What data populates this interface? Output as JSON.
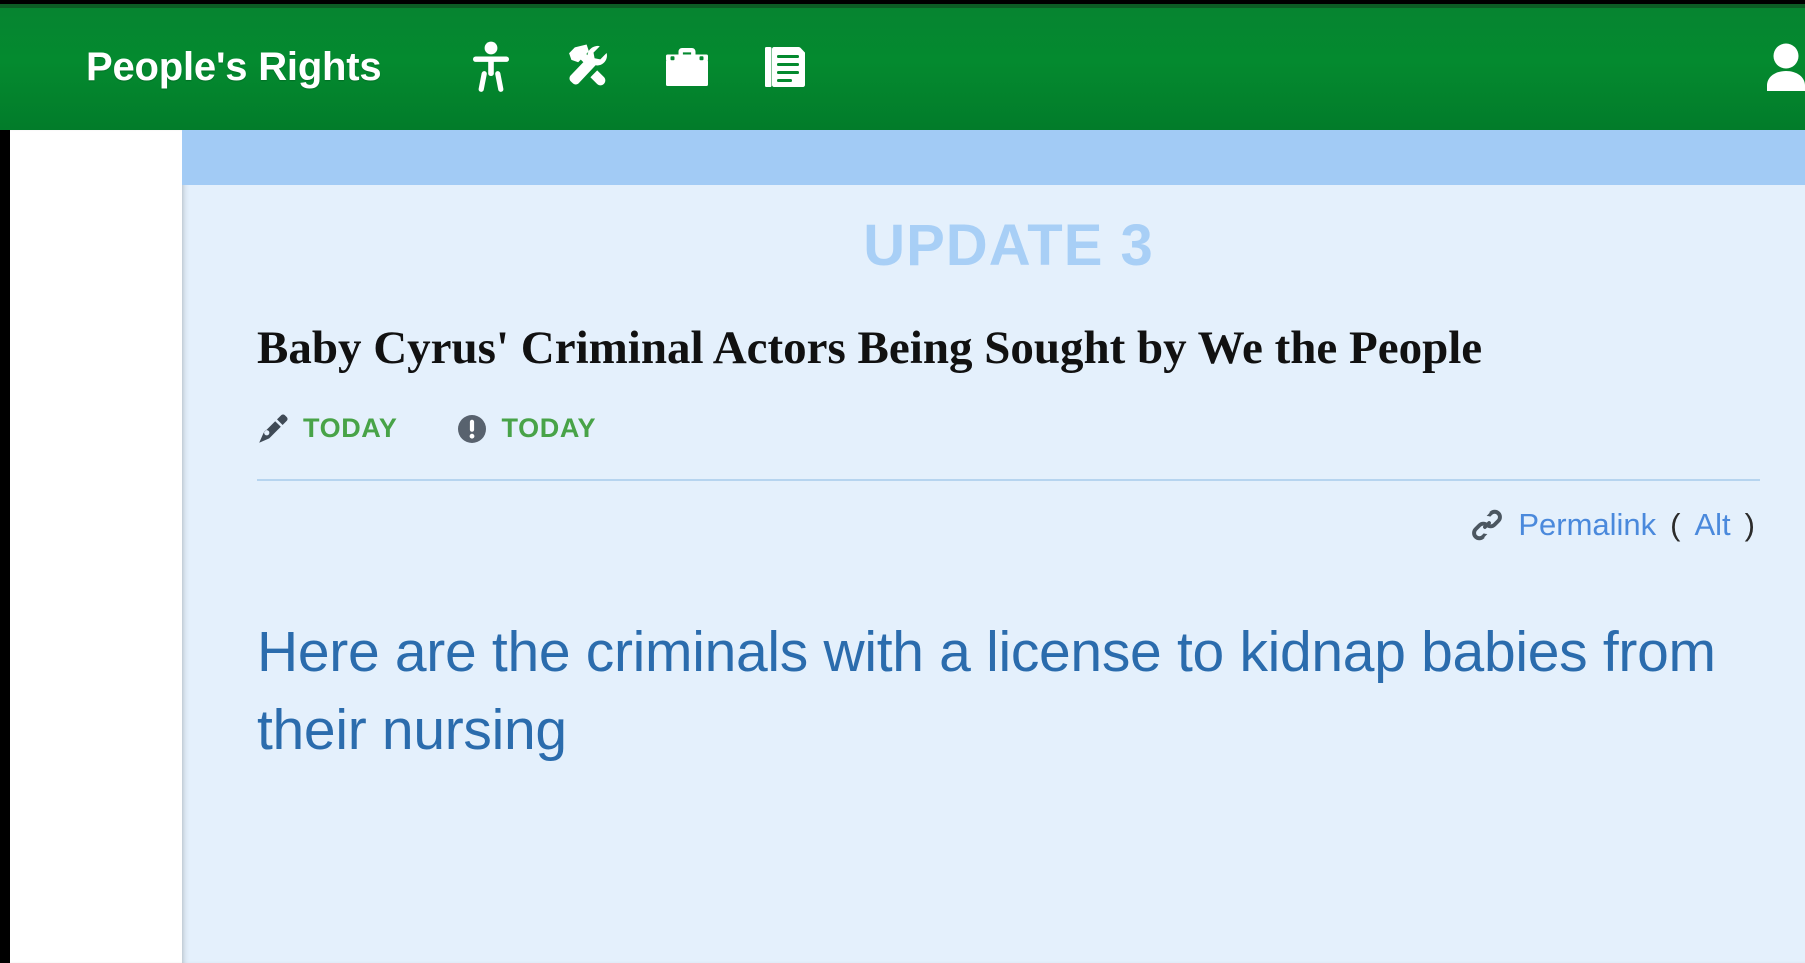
{
  "appbar": {
    "brand": "People's Rights",
    "background_color": "#048a2f",
    "nav_icons": [
      {
        "name": "accessibility-icon",
        "label": "Accessibility"
      },
      {
        "name": "tools-icon",
        "label": "Tools"
      },
      {
        "name": "toolbox-icon",
        "label": "Toolbox"
      },
      {
        "name": "notes-icon",
        "label": "Notes"
      }
    ],
    "right_action": {
      "name": "add-user-icon",
      "label": "Add user"
    }
  },
  "content": {
    "top_strip_color": "#a2cbf5",
    "background_color": "#e4f0fc",
    "update_label": "UPDATE 3",
    "update_label_color": "#a8cff6",
    "headline": "Baby Cyrus' Criminal Actors Being Sought by We the People",
    "meta": [
      {
        "icon": "pen-nib-icon",
        "text": "TODAY"
      },
      {
        "icon": "exclamation-circle-icon",
        "text": "TODAY"
      }
    ],
    "meta_text_color": "#48a348",
    "permalink": {
      "icon": "link-icon",
      "label": "Permalink",
      "open_paren": "(",
      "alt_label": "Alt",
      "close_paren": ")",
      "link_color": "#4a89dc"
    },
    "body_text": "Here are the criminals with a license to kidnap babies from their nursing",
    "body_text_color": "#2b6cad"
  }
}
